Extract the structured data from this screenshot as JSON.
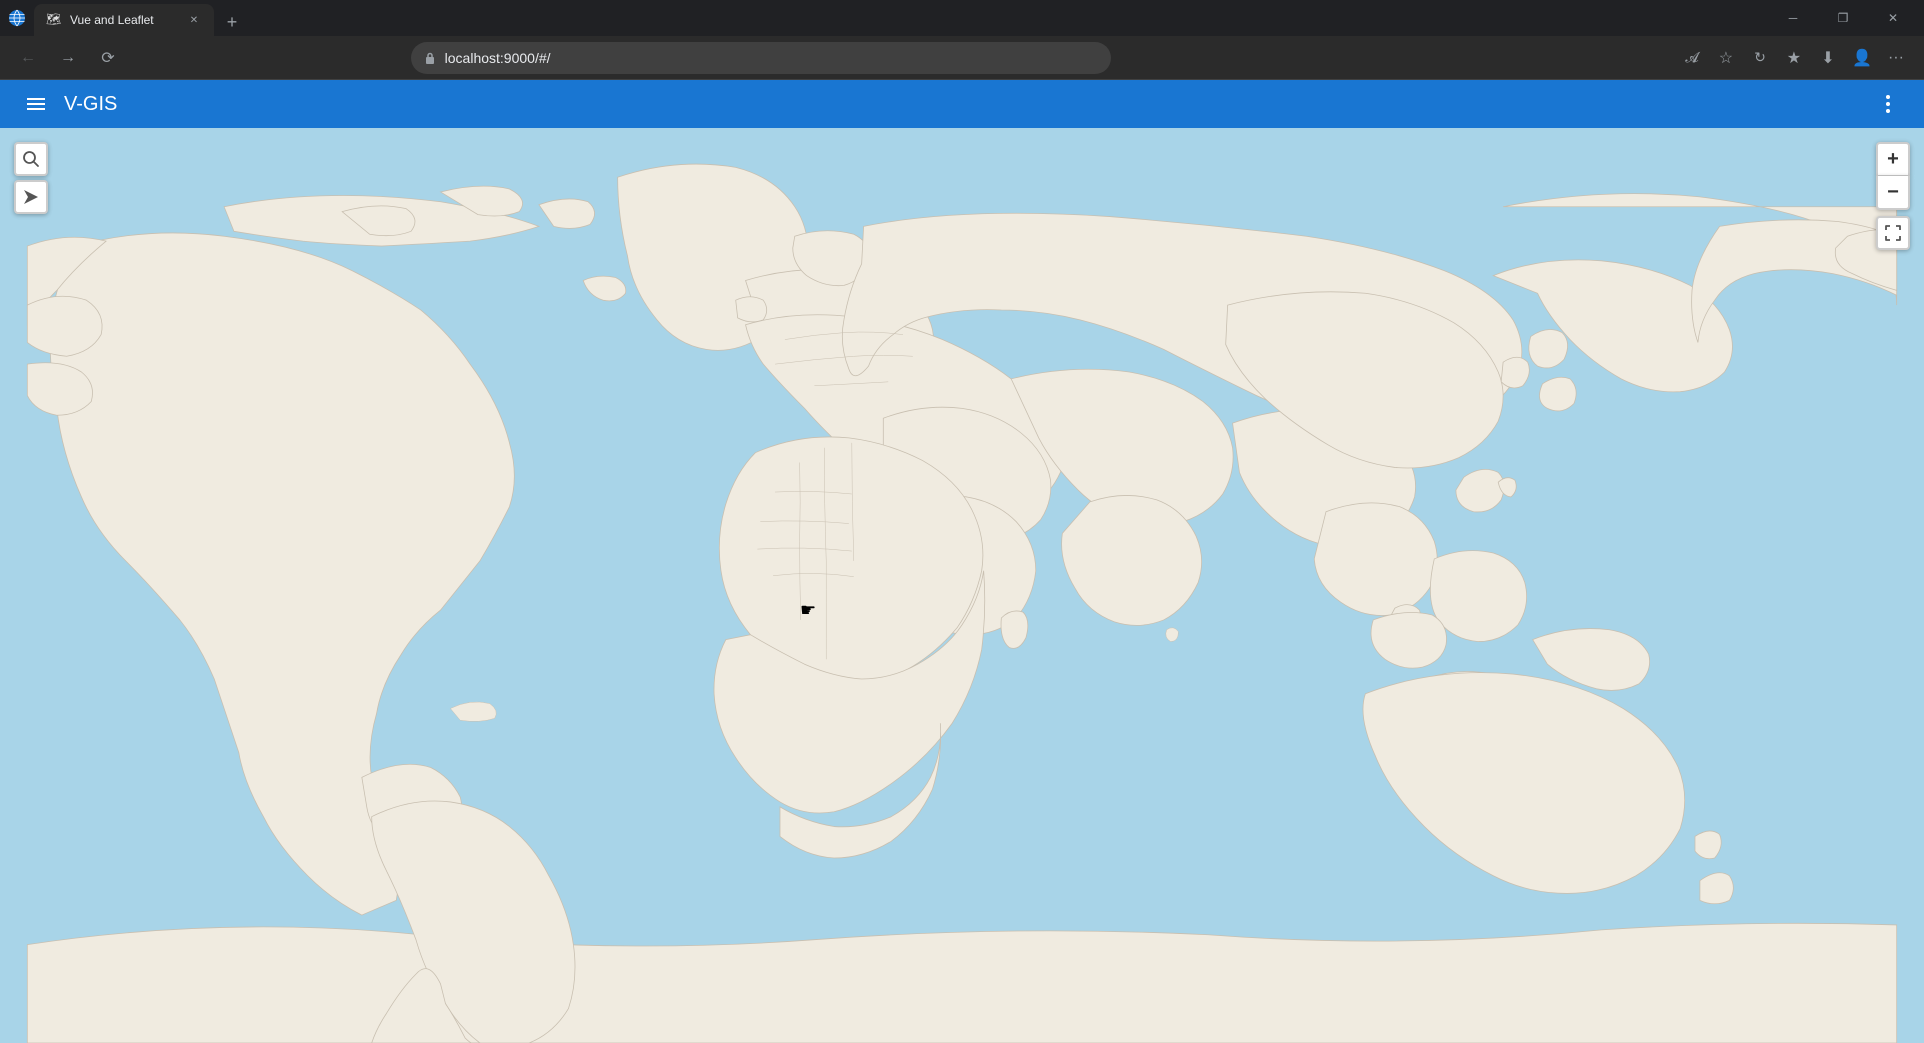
{
  "browser": {
    "title_bar": {
      "tab_title": "Vue and Leaflet",
      "tab_favicon": "🗺",
      "new_tab_icon": "+",
      "win_minimize": "─",
      "win_restore": "❐",
      "win_close": "✕"
    },
    "nav_bar": {
      "back_title": "Back",
      "forward_title": "Forward",
      "refresh_title": "Refresh",
      "address": "localhost:9000/#/",
      "reading_mode": "𝓐",
      "favorites": "☆",
      "collections": "↻",
      "browser_favorites": "★",
      "downloads": "⬇",
      "profile": "👤",
      "more": "···"
    }
  },
  "app": {
    "header": {
      "menu_icon": "≡",
      "title": "V-GIS",
      "more_icon": "⋮"
    },
    "map": {
      "search_icon": "🔍",
      "locate_icon": "➤",
      "zoom_in_label": "+",
      "zoom_out_label": "−",
      "fullscreen_icon": "⛶",
      "ocean_color": "#a8d4e8",
      "land_color": "#f0ebe0",
      "border_color": "#c8bfb0"
    }
  }
}
